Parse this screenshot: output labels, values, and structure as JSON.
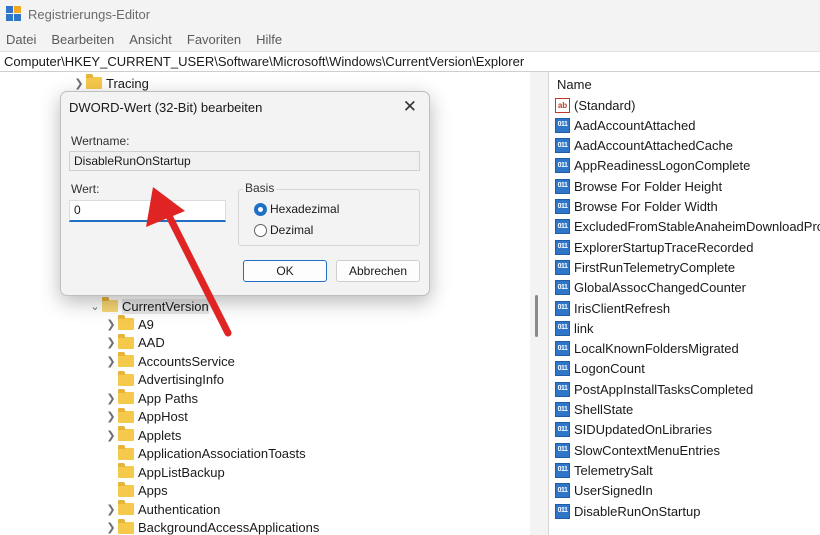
{
  "window": {
    "title": "Registrierungs-Editor"
  },
  "menu": [
    "Datei",
    "Bearbeiten",
    "Ansicht",
    "Favoriten",
    "Hilfe"
  ],
  "address": "Computer\\HKEY_CURRENT_USER\\Software\\Microsoft\\Windows\\CurrentVersion\\Explorer",
  "tree": {
    "top_item": "Tracing",
    "current_version": "CurrentVersion",
    "children": [
      {
        "label": "A9",
        "expandable": true
      },
      {
        "label": "AAD",
        "expandable": true
      },
      {
        "label": "AccountsService",
        "expandable": true
      },
      {
        "label": "AdvertisingInfo",
        "expandable": false
      },
      {
        "label": "App Paths",
        "expandable": true
      },
      {
        "label": "AppHost",
        "expandable": true
      },
      {
        "label": "Applets",
        "expandable": true
      },
      {
        "label": "ApplicationAssociationToasts",
        "expandable": false
      },
      {
        "label": "AppListBackup",
        "expandable": false
      },
      {
        "label": "Apps",
        "expandable": false
      },
      {
        "label": "Authentication",
        "expandable": true
      },
      {
        "label": "BackgroundAccessApplications",
        "expandable": true
      }
    ]
  },
  "list": {
    "header_name": "Name",
    "values": [
      {
        "name": "(Standard)",
        "kind": "string"
      },
      {
        "name": "AadAccountAttached",
        "kind": "binary"
      },
      {
        "name": "AadAccountAttachedCache",
        "kind": "binary"
      },
      {
        "name": "AppReadinessLogonComplete",
        "kind": "binary"
      },
      {
        "name": "Browse For Folder Height",
        "kind": "binary"
      },
      {
        "name": "Browse For Folder Width",
        "kind": "binary"
      },
      {
        "name": "ExcludedFromStableAnaheimDownloadPromotion",
        "kind": "binary"
      },
      {
        "name": "ExplorerStartupTraceRecorded",
        "kind": "binary"
      },
      {
        "name": "FirstRunTelemetryComplete",
        "kind": "binary"
      },
      {
        "name": "GlobalAssocChangedCounter",
        "kind": "binary"
      },
      {
        "name": "IrisClientRefresh",
        "kind": "binary"
      },
      {
        "name": "link",
        "kind": "binary"
      },
      {
        "name": "LocalKnownFoldersMigrated",
        "kind": "binary"
      },
      {
        "name": "LogonCount",
        "kind": "binary"
      },
      {
        "name": "PostAppInstallTasksCompleted",
        "kind": "binary"
      },
      {
        "name": "ShellState",
        "kind": "binary"
      },
      {
        "name": "SIDUpdatedOnLibraries",
        "kind": "binary"
      },
      {
        "name": "SlowContextMenuEntries",
        "kind": "binary"
      },
      {
        "name": "TelemetrySalt",
        "kind": "binary"
      },
      {
        "name": "UserSignedIn",
        "kind": "binary"
      },
      {
        "name": "DisableRunOnStartup",
        "kind": "binary"
      }
    ]
  },
  "dialog": {
    "title": "DWORD-Wert (32-Bit) bearbeiten",
    "close_glyph": "✕",
    "name_label": "Wertname:",
    "name_value": "DisableRunOnStartup",
    "value_label": "Wert:",
    "value": "0",
    "base_label": "Basis",
    "radio_hex": "Hexadezimal",
    "radio_dec": "Dezimal",
    "selected_base": "hex",
    "ok_label": "OK",
    "cancel_label": "Abbrechen"
  },
  "colors": {
    "accent": "#1f6fc5",
    "annotation_arrow": "#e02424",
    "folder": "#f5c94c"
  },
  "icons": {
    "app": "regedit-icon",
    "folder": "folder-icon",
    "binary_value": "reg-dword-icon",
    "string_value": "reg-string-icon",
    "close": "close-icon"
  }
}
